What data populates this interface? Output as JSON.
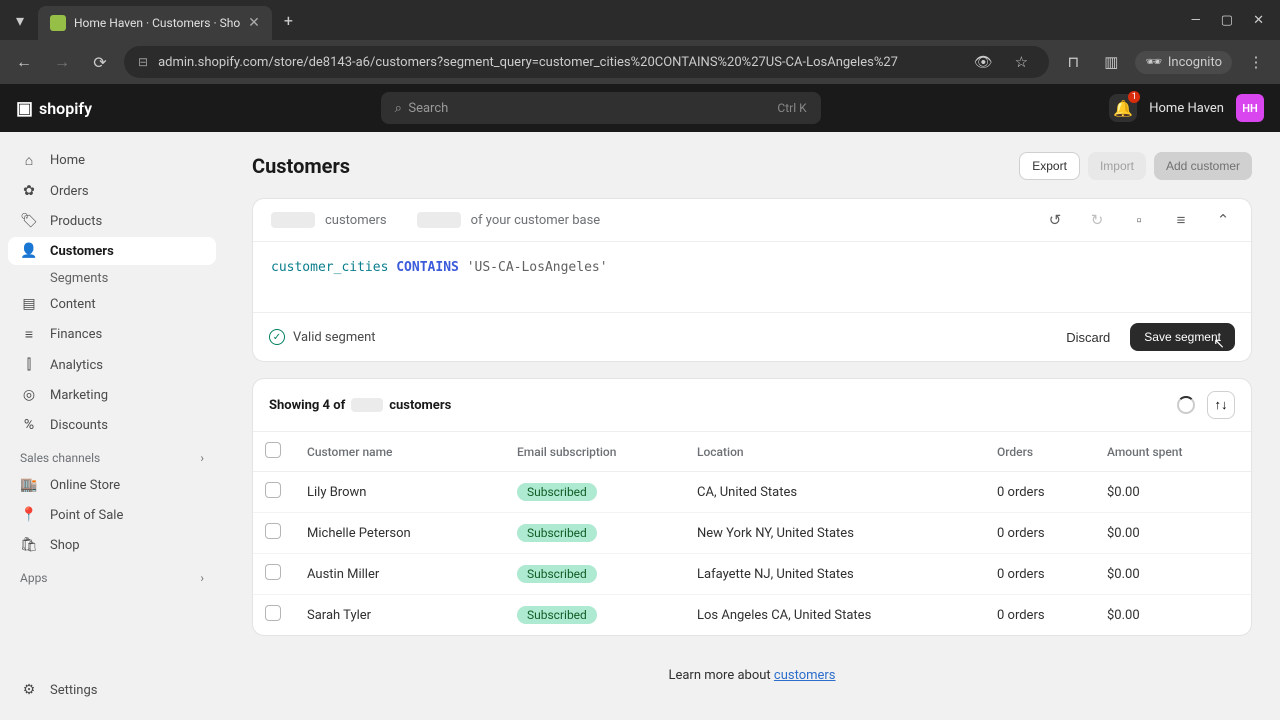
{
  "browser": {
    "tab_title": "Home Haven · Customers · Sho",
    "url": "admin.shopify.com/store/de8143-a6/customers?segment_query=customer_cities%20CONTAINS%20%27US-CA-LosAngeles%27",
    "incognito": "Incognito"
  },
  "header": {
    "logo": "shopify",
    "search_placeholder": "Search",
    "search_kbd": "Ctrl K",
    "notif_count": "1",
    "store_name": "Home Haven",
    "store_initials": "HH"
  },
  "sidebar": {
    "items": [
      {
        "icon": "⌂",
        "label": "Home"
      },
      {
        "icon": "✿",
        "label": "Orders"
      },
      {
        "icon": "🏷",
        "label": "Products"
      },
      {
        "icon": "👤",
        "label": "Customers",
        "active": true
      },
      {
        "icon": "▤",
        "label": "Content"
      },
      {
        "icon": "≡",
        "label": "Finances"
      },
      {
        "icon": "⫿",
        "label": "Analytics"
      },
      {
        "icon": "◎",
        "label": "Marketing"
      },
      {
        "icon": "%",
        "label": "Discounts"
      }
    ],
    "sub_customers": "Segments",
    "section_sales": "Sales channels",
    "sales_items": [
      {
        "icon": "🏬",
        "label": "Online Store"
      },
      {
        "icon": "📍",
        "label": "Point of Sale"
      },
      {
        "icon": "🛍",
        "label": "Shop"
      }
    ],
    "section_apps": "Apps",
    "settings": "Settings"
  },
  "page": {
    "title": "Customers",
    "actions": {
      "export": "Export",
      "import": "Import",
      "add": "Add customer"
    }
  },
  "segment": {
    "head_customers": "customers",
    "head_base": "of your customer base",
    "query": {
      "field": "customer_cities",
      "op": "CONTAINS",
      "value": "'US-CA-LosAngeles'"
    },
    "valid_label": "Valid segment",
    "discard": "Discard",
    "save": "Save segment"
  },
  "listing": {
    "showing_prefix": "Showing 4 of",
    "showing_suffix": "customers",
    "columns": {
      "name": "Customer name",
      "sub": "Email subscription",
      "loc": "Location",
      "orders": "Orders",
      "spent": "Amount spent"
    },
    "sub_badge": "Subscribed",
    "rows": [
      {
        "name": "Lily Brown",
        "loc": "CA, United States",
        "orders": "0 orders",
        "spent": "$0.00"
      },
      {
        "name": "Michelle Peterson",
        "loc": "New York NY, United States",
        "orders": "0 orders",
        "spent": "$0.00"
      },
      {
        "name": "Austin Miller",
        "loc": "Lafayette NJ, United States",
        "orders": "0 orders",
        "spent": "$0.00"
      },
      {
        "name": "Sarah Tyler",
        "loc": "Los Angeles CA, United States",
        "orders": "0 orders",
        "spent": "$0.00"
      }
    ]
  },
  "footer": {
    "learn_prefix": "Learn more about ",
    "learn_link": "customers"
  }
}
